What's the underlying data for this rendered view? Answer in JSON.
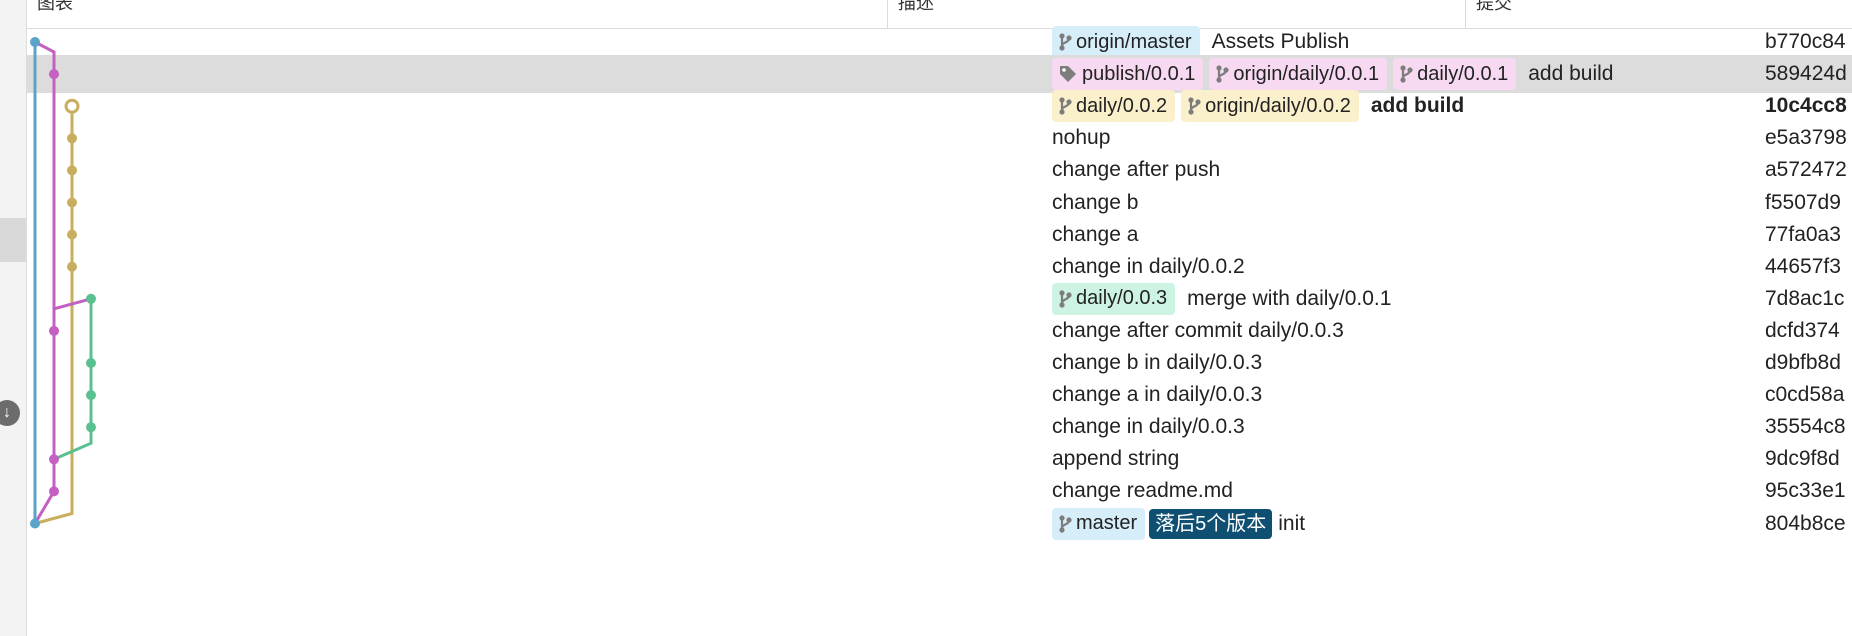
{
  "header": {
    "col_graph": "图表",
    "col_desc": "描述",
    "col_commit": "提交"
  },
  "side": {
    "scroll_button_glyph": "↓"
  },
  "colors": {
    "lane_blue": "#5ba3c9",
    "lane_pink": "#c460c2",
    "lane_yellow": "#c9ae5f",
    "lane_green": "#5ac08f",
    "tag_blue_bg": "#d6eefa",
    "tag_pink_bg": "#f7d9f1",
    "tag_yellow_bg": "#fbf0cc",
    "tag_green_bg": "#cdf3e3",
    "behind_bg": "#0e4f72",
    "selected_row": "#dcdcdc"
  },
  "commits": [
    {
      "hash": "b770c84",
      "message": "Assets Publish",
      "refs": [
        {
          "type": "branch",
          "icon": "branch-icon",
          "label": "origin/master",
          "color": "blue"
        }
      ]
    },
    {
      "hash": "589424d",
      "message": "add build",
      "selected": true,
      "refs": [
        {
          "type": "tag",
          "icon": "tag-icon",
          "label": "publish/0.0.1",
          "color": "pink"
        },
        {
          "type": "branch",
          "icon": "branch-icon",
          "label": "origin/daily/0.0.1",
          "color": "pink"
        },
        {
          "type": "branch",
          "icon": "branch-icon",
          "label": "daily/0.0.1",
          "color": "pink"
        }
      ]
    },
    {
      "hash": "10c4cc8",
      "message": "add build",
      "bold": true,
      "refs": [
        {
          "type": "branch",
          "icon": "branch-icon",
          "label": "daily/0.0.2",
          "color": "yellow"
        },
        {
          "type": "branch",
          "icon": "branch-icon",
          "label": "origin/daily/0.0.2",
          "color": "yellow"
        }
      ]
    },
    {
      "hash": "e5a3798",
      "message": "nohup",
      "refs": []
    },
    {
      "hash": "a572472",
      "message": "change after push",
      "refs": []
    },
    {
      "hash": "f5507d9",
      "message": "change b",
      "refs": []
    },
    {
      "hash": "77fa0a3",
      "message": "change a",
      "refs": []
    },
    {
      "hash": "44657f3",
      "message": "change in daily/0.0.2",
      "refs": []
    },
    {
      "hash": "7d8ac1c",
      "message": "merge with daily/0.0.1",
      "refs": [
        {
          "type": "branch",
          "icon": "branch-icon",
          "label": "daily/0.0.3",
          "color": "green"
        }
      ]
    },
    {
      "hash": "dcfd374",
      "message": "change after commit daily/0.0.3",
      "refs": []
    },
    {
      "hash": "d9bfb8d",
      "message": "change b in daily/0.0.3",
      "refs": []
    },
    {
      "hash": "c0cd58a",
      "message": "change a in daily/0.0.3",
      "refs": []
    },
    {
      "hash": "35554c8",
      "message": "change in daily/0.0.3",
      "refs": []
    },
    {
      "hash": "9dc9f8d",
      "message": "append string",
      "refs": []
    },
    {
      "hash": "95c33e1",
      "message": "change readme.md",
      "refs": []
    },
    {
      "hash": "804b8ce",
      "message": "init",
      "refs": [
        {
          "type": "branch",
          "icon": "branch-icon",
          "label": "master",
          "color": "blue"
        }
      ],
      "behind_badge": "落后5个版本"
    }
  ]
}
